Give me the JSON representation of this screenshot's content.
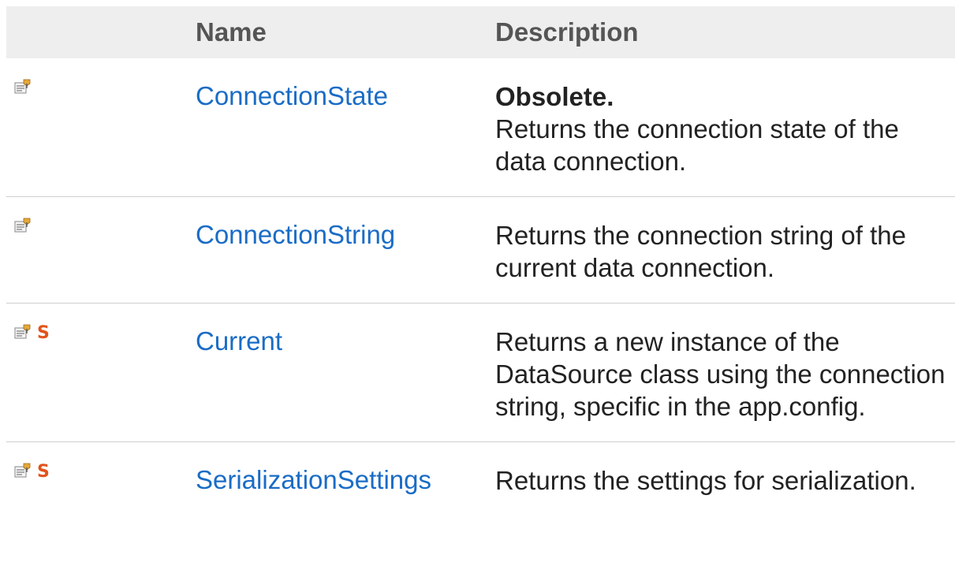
{
  "table": {
    "headers": {
      "icons": "",
      "name": "Name",
      "description": "Description"
    },
    "rows": [
      {
        "icons": [
          "property-icon"
        ],
        "name": "ConnectionState",
        "obsolete": "Obsolete.",
        "description": "Returns the connection state of the data connection."
      },
      {
        "icons": [
          "property-icon"
        ],
        "name": "ConnectionString",
        "obsolete": "",
        "description": "Returns the connection string of the current data connection."
      },
      {
        "icons": [
          "property-icon",
          "static-icon"
        ],
        "static_glyph": "S",
        "name": "Current",
        "obsolete": "",
        "description": "Returns a new instance of the DataSource class using the connection string, specific in the app.config."
      },
      {
        "icons": [
          "property-icon",
          "static-icon"
        ],
        "static_glyph": "S",
        "name": "SerializationSettings",
        "obsolete": "",
        "description": "Returns the settings for serialization."
      }
    ]
  },
  "colors": {
    "link": "#1a6cc6",
    "header_bg": "#eeeeee",
    "header_text": "#555555",
    "static_badge": "#e2531a"
  }
}
